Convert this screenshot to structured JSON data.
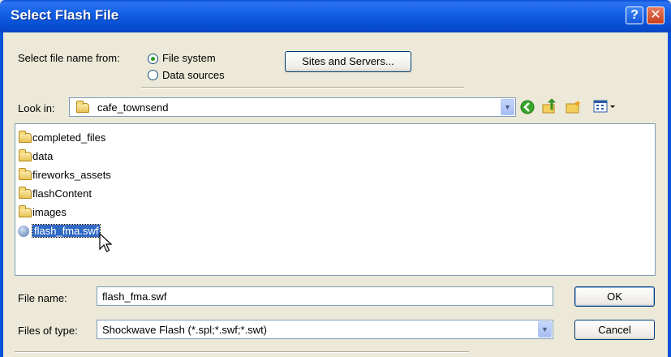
{
  "window": {
    "title": "Select Flash File",
    "help_glyph": "?",
    "close_glyph": "✕"
  },
  "source": {
    "label": "Select file name from:",
    "options": [
      {
        "label": "File system",
        "selected": true
      },
      {
        "label": "Data sources",
        "selected": false
      }
    ],
    "sites_button": "Sites and Servers..."
  },
  "look_in": {
    "label": "Look in:",
    "folder": "cafe_townsend"
  },
  "toolbar": {
    "icons": [
      "back-icon",
      "up-folder-icon",
      "new-folder-icon",
      "view-menu-icon"
    ]
  },
  "files": [
    {
      "name": "completed_files",
      "type": "folder"
    },
    {
      "name": "data",
      "type": "folder"
    },
    {
      "name": "fireworks_assets",
      "type": "folder"
    },
    {
      "name": "flashContent",
      "type": "folder"
    },
    {
      "name": "images",
      "type": "folder"
    },
    {
      "name": "flash_fma.swf",
      "type": "swf",
      "selected": true
    }
  ],
  "file_name": {
    "label": "File name:",
    "value": "flash_fma.swf"
  },
  "file_type": {
    "label": "Files of type:",
    "value": "Shockwave Flash (*.spl;*.swf;*.swt)"
  },
  "buttons": {
    "ok": "OK",
    "cancel": "Cancel"
  },
  "colors": {
    "title_bar": "#0a52d8",
    "selection": "#316ac5",
    "dialog_bg": "#ece9d8"
  }
}
